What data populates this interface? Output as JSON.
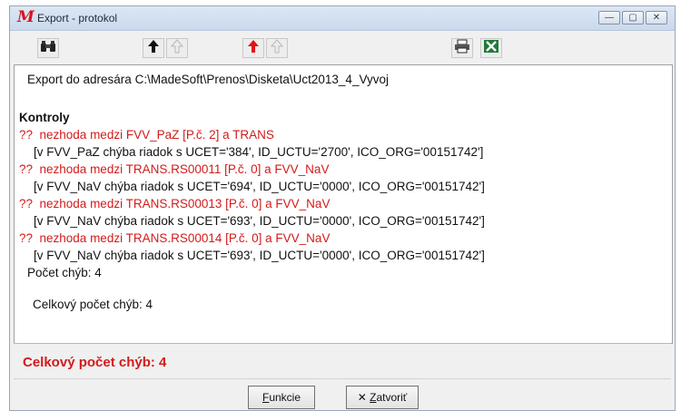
{
  "window": {
    "title": "Export - protokol",
    "controls": {
      "minimize": "—",
      "maximize": "▢",
      "close": "✕"
    }
  },
  "toolbar": {
    "icons": [
      "binoculars-icon",
      "up-arrow-icon",
      "up-arrow-disabled-icon",
      "red-up-arrow-icon",
      "red-up-arrow-disabled-icon",
      "printer-icon",
      "excel-icon"
    ]
  },
  "log": {
    "export_line": "Export do adresára C:\\MadeSoft\\Prenos\\Disketa\\Uct2013_4_Vyvoj",
    "section_heading": "Kontroly",
    "entries": [
      {
        "issue": "??  nezhoda medzi FVV_PaZ [P.č. 2] a TRANS",
        "detail": "[v FVV_PaZ chýba riadok s UCET='384', ID_UCTU='2700', ICO_ORG='00151742']"
      },
      {
        "issue": "??  nezhoda medzi TRANS.RS00011 [P.č. 0] a FVV_NaV",
        "detail": "[v FVV_NaV chýba riadok s UCET='694', ID_UCTU='0000', ICO_ORG='00151742']"
      },
      {
        "issue": "??  nezhoda medzi TRANS.RS00013 [P.č. 0] a FVV_NaV",
        "detail": "[v FVV_NaV chýba riadok s UCET='693', ID_UCTU='0000', ICO_ORG='00151742']"
      },
      {
        "issue": "??  nezhoda medzi TRANS.RS00014 [P.č. 0] a FVV_NaV",
        "detail": "[v FVV_NaV chýba riadok s UCET='693', ID_UCTU='0000', ICO_ORG='00151742']"
      }
    ],
    "error_count": "Počet chýb: 4",
    "total_error_count": "Celkový počet chýb: 4"
  },
  "status": {
    "summary": "Celkový počet chýb: 4"
  },
  "buttons": {
    "functions_accel": "F",
    "functions_rest": "unkcie",
    "close_icon": "✕",
    "close_accel": "Z",
    "close_rest": "atvoriť"
  },
  "colors": {
    "error": "#d51a1a",
    "titlebar": "#cad9ec"
  }
}
